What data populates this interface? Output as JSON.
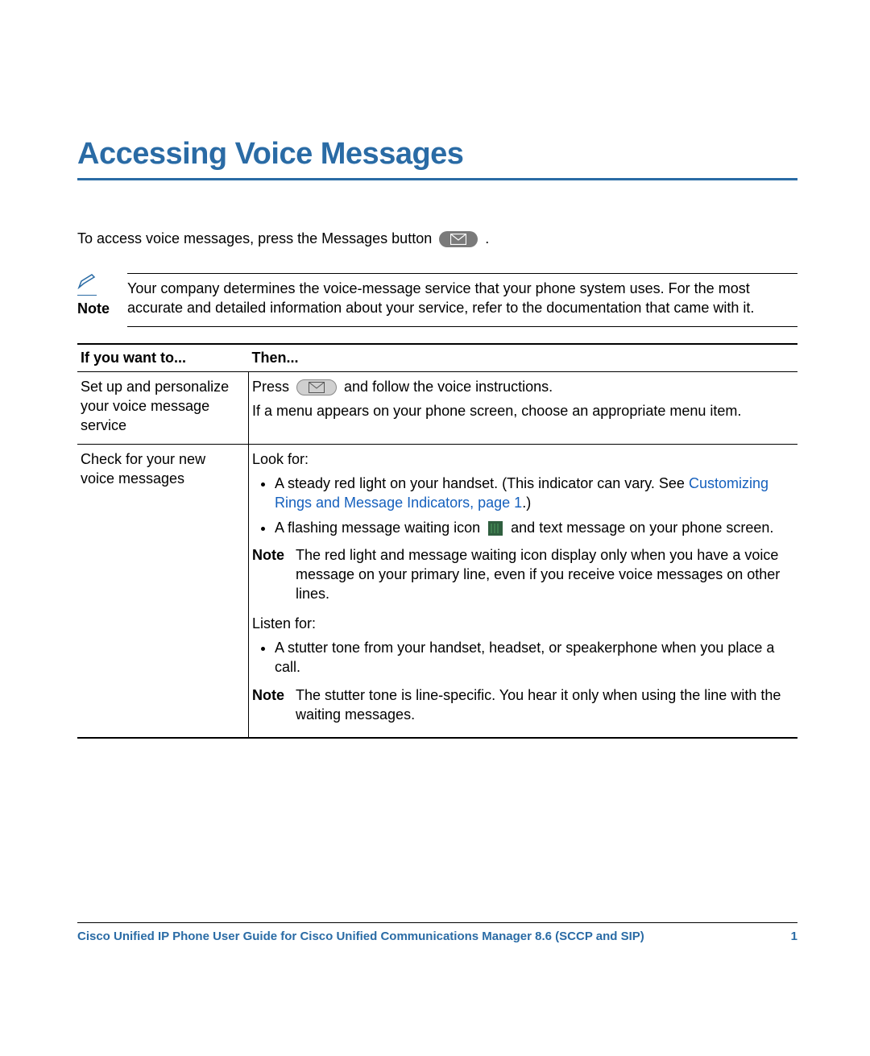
{
  "title": "Accessing Voice Messages",
  "intro": {
    "prefix": "To access voice messages, press the Messages button ",
    "suffix": "."
  },
  "top_note": {
    "label": "Note",
    "body": "Your company determines the voice-message service that your phone system uses. For the most accurate and detailed information about your service, refer to the documentation that came with it."
  },
  "table": {
    "headers": {
      "left": "If you want to...",
      "right": "Then..."
    },
    "rows": [
      {
        "left": "Set up and personalize your voice message service",
        "right": {
          "press_prefix": "Press ",
          "press_suffix": " and follow the voice instructions.",
          "line2": "If a menu appears on your phone screen, choose an appropriate menu item."
        }
      },
      {
        "left": "Check for your new voice messages",
        "right": {
          "look_header": "Look for:",
          "bullet1_prefix": "A steady red light on your handset. (This indicator can vary. See ",
          "bullet1_link": "Customizing Rings and Message Indicators, page 1",
          "bullet1_suffix": ".)",
          "bullet2_prefix": "A flashing message waiting icon ",
          "bullet2_suffix": " and text message on your phone screen.",
          "note1_label": "Note",
          "note1_body": "The red light and message waiting icon display only when you have a voice message on your primary line, even if you receive voice messages on other lines.",
          "listen_header": "Listen for:",
          "bullet3": "A stutter tone from your handset, headset, or speakerphone when you place a call.",
          "note2_label": "Note",
          "note2_body": "The stutter tone is line-specific. You hear it only when using the line with the waiting messages."
        }
      }
    ]
  },
  "footer": {
    "title": "Cisco Unified IP Phone User Guide for Cisco Unified Communications Manager 8.6 (SCCP and SIP)",
    "page": "1"
  }
}
